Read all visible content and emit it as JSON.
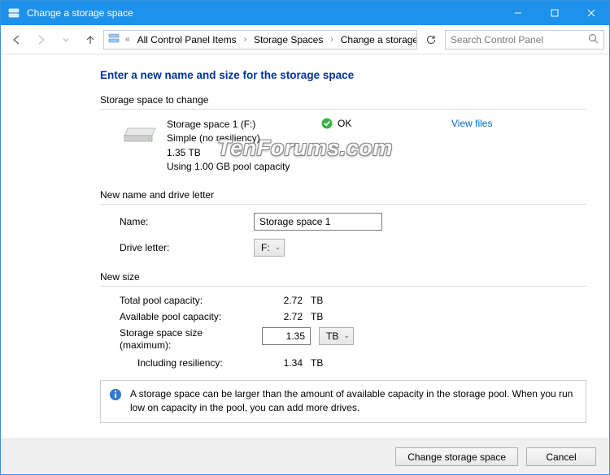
{
  "titlebar": {
    "title": "Change a storage space"
  },
  "breadcrumb": {
    "items": [
      "All Control Panel Items",
      "Storage Spaces",
      "Change a storage space"
    ]
  },
  "search": {
    "placeholder": "Search Control Panel"
  },
  "page": {
    "heading": "Enter a new name and size for the storage space"
  },
  "sections": {
    "to_change": "Storage space to change",
    "name_letter": "New name and drive letter",
    "new_size": "New size"
  },
  "storage": {
    "name_line": "Storage space 1 (F:)",
    "type_line": "Simple (no resiliency)",
    "size_line": "1.35 TB",
    "using_line": "Using 1.00 GB pool capacity",
    "status": "OK",
    "view_files": "View files"
  },
  "form": {
    "name_label": "Name:",
    "name_value": "Storage space 1",
    "drive_letter_label": "Drive letter:",
    "drive_letter_value": "F:",
    "total_pool_label": "Total pool capacity:",
    "total_pool_value": "2.72",
    "total_pool_unit": "TB",
    "avail_pool_label": "Available pool capacity:",
    "avail_pool_value": "2.72",
    "avail_pool_unit": "TB",
    "size_label": "Storage space size (maximum):",
    "size_value": "1.35",
    "size_unit": "TB",
    "resiliency_label": "Including resiliency:",
    "resiliency_value": "1.34",
    "resiliency_unit": "TB"
  },
  "info": {
    "text": "A storage space can be larger than the amount of available capacity in the storage pool. When you run low on capacity in the pool, you can add more drives."
  },
  "buttons": {
    "change": "Change storage space",
    "cancel": "Cancel"
  },
  "watermark": "TenForums.com"
}
